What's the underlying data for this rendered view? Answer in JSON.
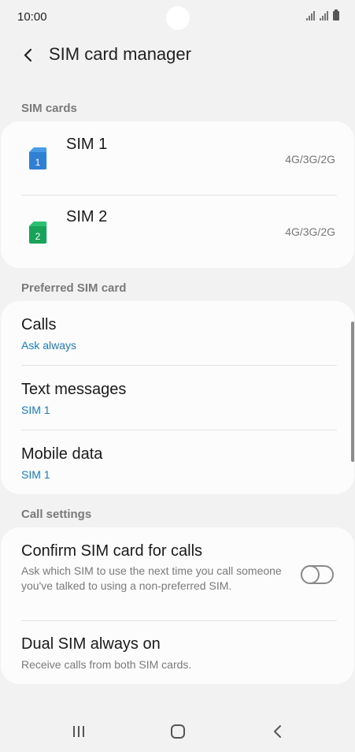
{
  "status_bar": {
    "time": "10:00"
  },
  "app_bar": {
    "title": "SIM card manager"
  },
  "sections": {
    "sim_cards": "SIM cards",
    "preferred": "Preferred SIM card",
    "call_settings": "Call settings"
  },
  "sims": [
    {
      "name": "SIM 1",
      "number": "1",
      "network": "4G/3G/2G",
      "color": "#2f7fd3"
    },
    {
      "name": "SIM 2",
      "number": "2",
      "network": "4G/3G/2G",
      "color": "#19a25a"
    }
  ],
  "preferred": {
    "calls": {
      "title": "Calls",
      "value": "Ask always"
    },
    "text": {
      "title": "Text messages",
      "value": "SIM 1"
    },
    "data": {
      "title": "Mobile data",
      "value": "SIM 1"
    }
  },
  "call_settings": {
    "confirm": {
      "title": "Confirm SIM card for calls",
      "desc": "Ask which SIM to use the next time you call someone you've talked to using a non-preferred SIM.",
      "enabled": false
    },
    "dual": {
      "title": "Dual SIM always on",
      "desc": "Receive calls from both SIM cards."
    }
  },
  "colors": {
    "accent_blue": "#1a7bc2",
    "background": "#f2f2f2",
    "card": "#fcfcfc"
  }
}
